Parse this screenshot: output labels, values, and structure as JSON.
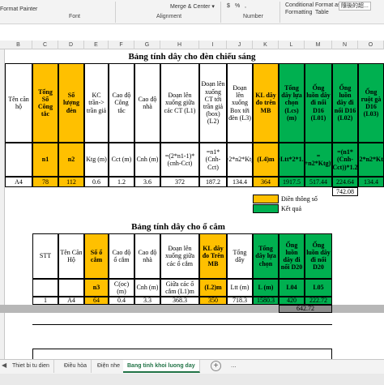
{
  "ribbon": {
    "format_painter": "Format Painter",
    "merge_center": "Merge & Center",
    "currency": "$",
    "percent": "%",
    "comma": ",",
    "conditional_formatting_1": "Conditional",
    "conditional_formatting_2": "Formatting",
    "format_as_table_1": "Format as",
    "format_as_table_2": "Table",
    "cjk_style": "隨後的超...",
    "group_font": "Font",
    "group_alignment": "Alignment",
    "group_number": "Number"
  },
  "columns": [
    "B",
    "C",
    "D",
    "E",
    "F",
    "G",
    "H",
    "I",
    "J",
    "K",
    "L",
    "M",
    "N",
    "O"
  ],
  "table1": {
    "title": "Bảng tính dây cho đèn chiếu sáng",
    "headers": [
      "Tên căn hộ",
      "Tổng Số Công tắc",
      "Số lượng đèn",
      "KC trần-> trần giả",
      "Cao độ Công tắc",
      "Cao độ nhà",
      "Đoạn lên xuống giữa các CT (L1)",
      "Đoạn lên xuống CT tới trần giả (box) (L2)",
      "Đoạn lên xuống Box tới đèn (L3)",
      "KL dây đo trên MB",
      "Tổng dây lựa chọn (Lcs) (m)",
      "Ống luồn dây đi nổi D16 (L01)",
      "Ống luồn dây đi nổi D16 (L02)",
      "Ống ruột gà D16 (L03)"
    ],
    "sub": [
      "",
      "n1",
      "n2",
      "Ktg (m)",
      "Cct (m)",
      "Cnh (m)",
      "=(2*n1-1)*(cnh-Cct)",
      "=n1*(Cnh-Cct)",
      "=2*n2*Ktg",
      "(L4)m",
      "=Ltt*2*1.2",
      "=(L4+n2*Ktg)*1.2",
      "=(n1*(Cnh-Cct))*1.2",
      "=2*n2*Ktg"
    ],
    "row": [
      "A4",
      "78",
      "112",
      "0.6",
      "1.2",
      "3.6",
      "372",
      "187.2",
      "134.4",
      "364",
      "1917.5",
      "517.44",
      "224.64",
      "134.4"
    ],
    "sum": "742.08"
  },
  "legend": {
    "input": "Điền thông số",
    "result": "Kết quả"
  },
  "table2": {
    "title": "Bảng tính dây cho ổ cắm",
    "headers": [
      "STT",
      "Tên Căn Hộ",
      "Số ổ cắm",
      "Cao độ ổ cắm",
      "Cao độ nhà",
      "Đoạn lên xuống giữa các ổ cắm",
      "KL dây đo Trên MB",
      "Tổng dây",
      "Tổng dây lựa chọn",
      "Ống luồn dây đi nổi D20",
      "Ống luồn dây đi nổi D20"
    ],
    "sub": [
      "",
      "",
      "n3",
      "C(oc) (m)",
      "Cnh (m)",
      "Giữa các ổ cắm (L1)m",
      "(L2)m",
      "Ltt (m)",
      "L (m)",
      "L04",
      "L05"
    ],
    "row": [
      "1",
      "A4",
      "64",
      "0.4",
      "3.3",
      "368.3",
      "350",
      "718.3",
      "1580.3",
      "420",
      "222.72"
    ],
    "sum": "642.72"
  },
  "sheet_tabs": {
    "tabs": [
      "Thiet bi tu dien",
      "Điều hòa",
      "Điện nhe",
      "Bang tinh khoi luong day"
    ],
    "active_index": 3,
    "prev_icon": "◀",
    "next_icon": "▶",
    "more_icon": "...",
    "add_icon": "+"
  },
  "colors": {
    "yellow": "#ffc000",
    "green": "#00b050",
    "excel_green": "#217346"
  }
}
